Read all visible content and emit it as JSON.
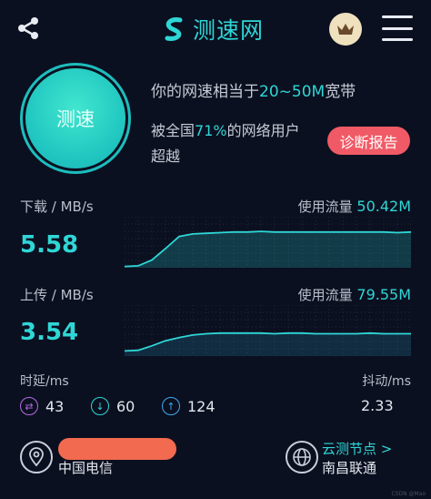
{
  "header": {
    "brand": "测速网",
    "icons": {
      "share": "share-icon",
      "brand_logo": "s-logo-icon",
      "vip": "crown-icon",
      "menu": "hamburger-menu-icon"
    }
  },
  "hero": {
    "button_label": "测速",
    "bandwidth_prefix": "你的网速相当于",
    "bandwidth_value": "20~50M",
    "bandwidth_suffix": "宽带",
    "beat_prefix": "被全国",
    "beat_value": "71%",
    "beat_suffix": "的网络用户",
    "beat_line2": "超越",
    "report_button": "诊断报告"
  },
  "download": {
    "label": "下载 / MB/s",
    "value": "5.58",
    "usage_label": "使用流量",
    "usage_value": "50.42M"
  },
  "upload": {
    "label": "上传 / MB/s",
    "value": "3.54",
    "usage_label": "使用流量",
    "usage_value": "79.55M"
  },
  "latency": {
    "label": "时延/ms",
    "jitter_label": "抖动/ms",
    "ping": "43",
    "down": "60",
    "up": "124",
    "jitter": "2.33"
  },
  "footer": {
    "isp": "中国电信",
    "node_link": "云测节点 >",
    "node_name": "南昌联通",
    "icons": {
      "location": "location-pin-icon",
      "globe": "globe-icon"
    }
  },
  "watermark": "CSDN @Mao",
  "colors": {
    "accent": "#2fd6d6",
    "report": "#f05a66",
    "background": "#0b1020",
    "redaction": "#f26a4f"
  },
  "chart_data": [
    {
      "type": "area",
      "series": [
        {
          "values": [
            0.2,
            0.3,
            1.2,
            3.0,
            4.9,
            5.3,
            5.4,
            5.5,
            5.6,
            5.6,
            5.7,
            5.6,
            5.6,
            5.6,
            5.6,
            5.6,
            5.6,
            5.6,
            5.6,
            5.6,
            5.5,
            5.6
          ]
        }
      ],
      "ylim": [
        0,
        8
      ]
    },
    {
      "type": "area",
      "series": [
        {
          "values": [
            0.8,
            0.9,
            1.6,
            2.4,
            2.9,
            3.3,
            3.5,
            3.6,
            3.6,
            3.6,
            3.6,
            3.5,
            3.6,
            3.6,
            3.5,
            3.5,
            3.5,
            3.5,
            3.6,
            3.5,
            3.5,
            3.5
          ]
        }
      ],
      "ylim": [
        0,
        8
      ]
    }
  ]
}
